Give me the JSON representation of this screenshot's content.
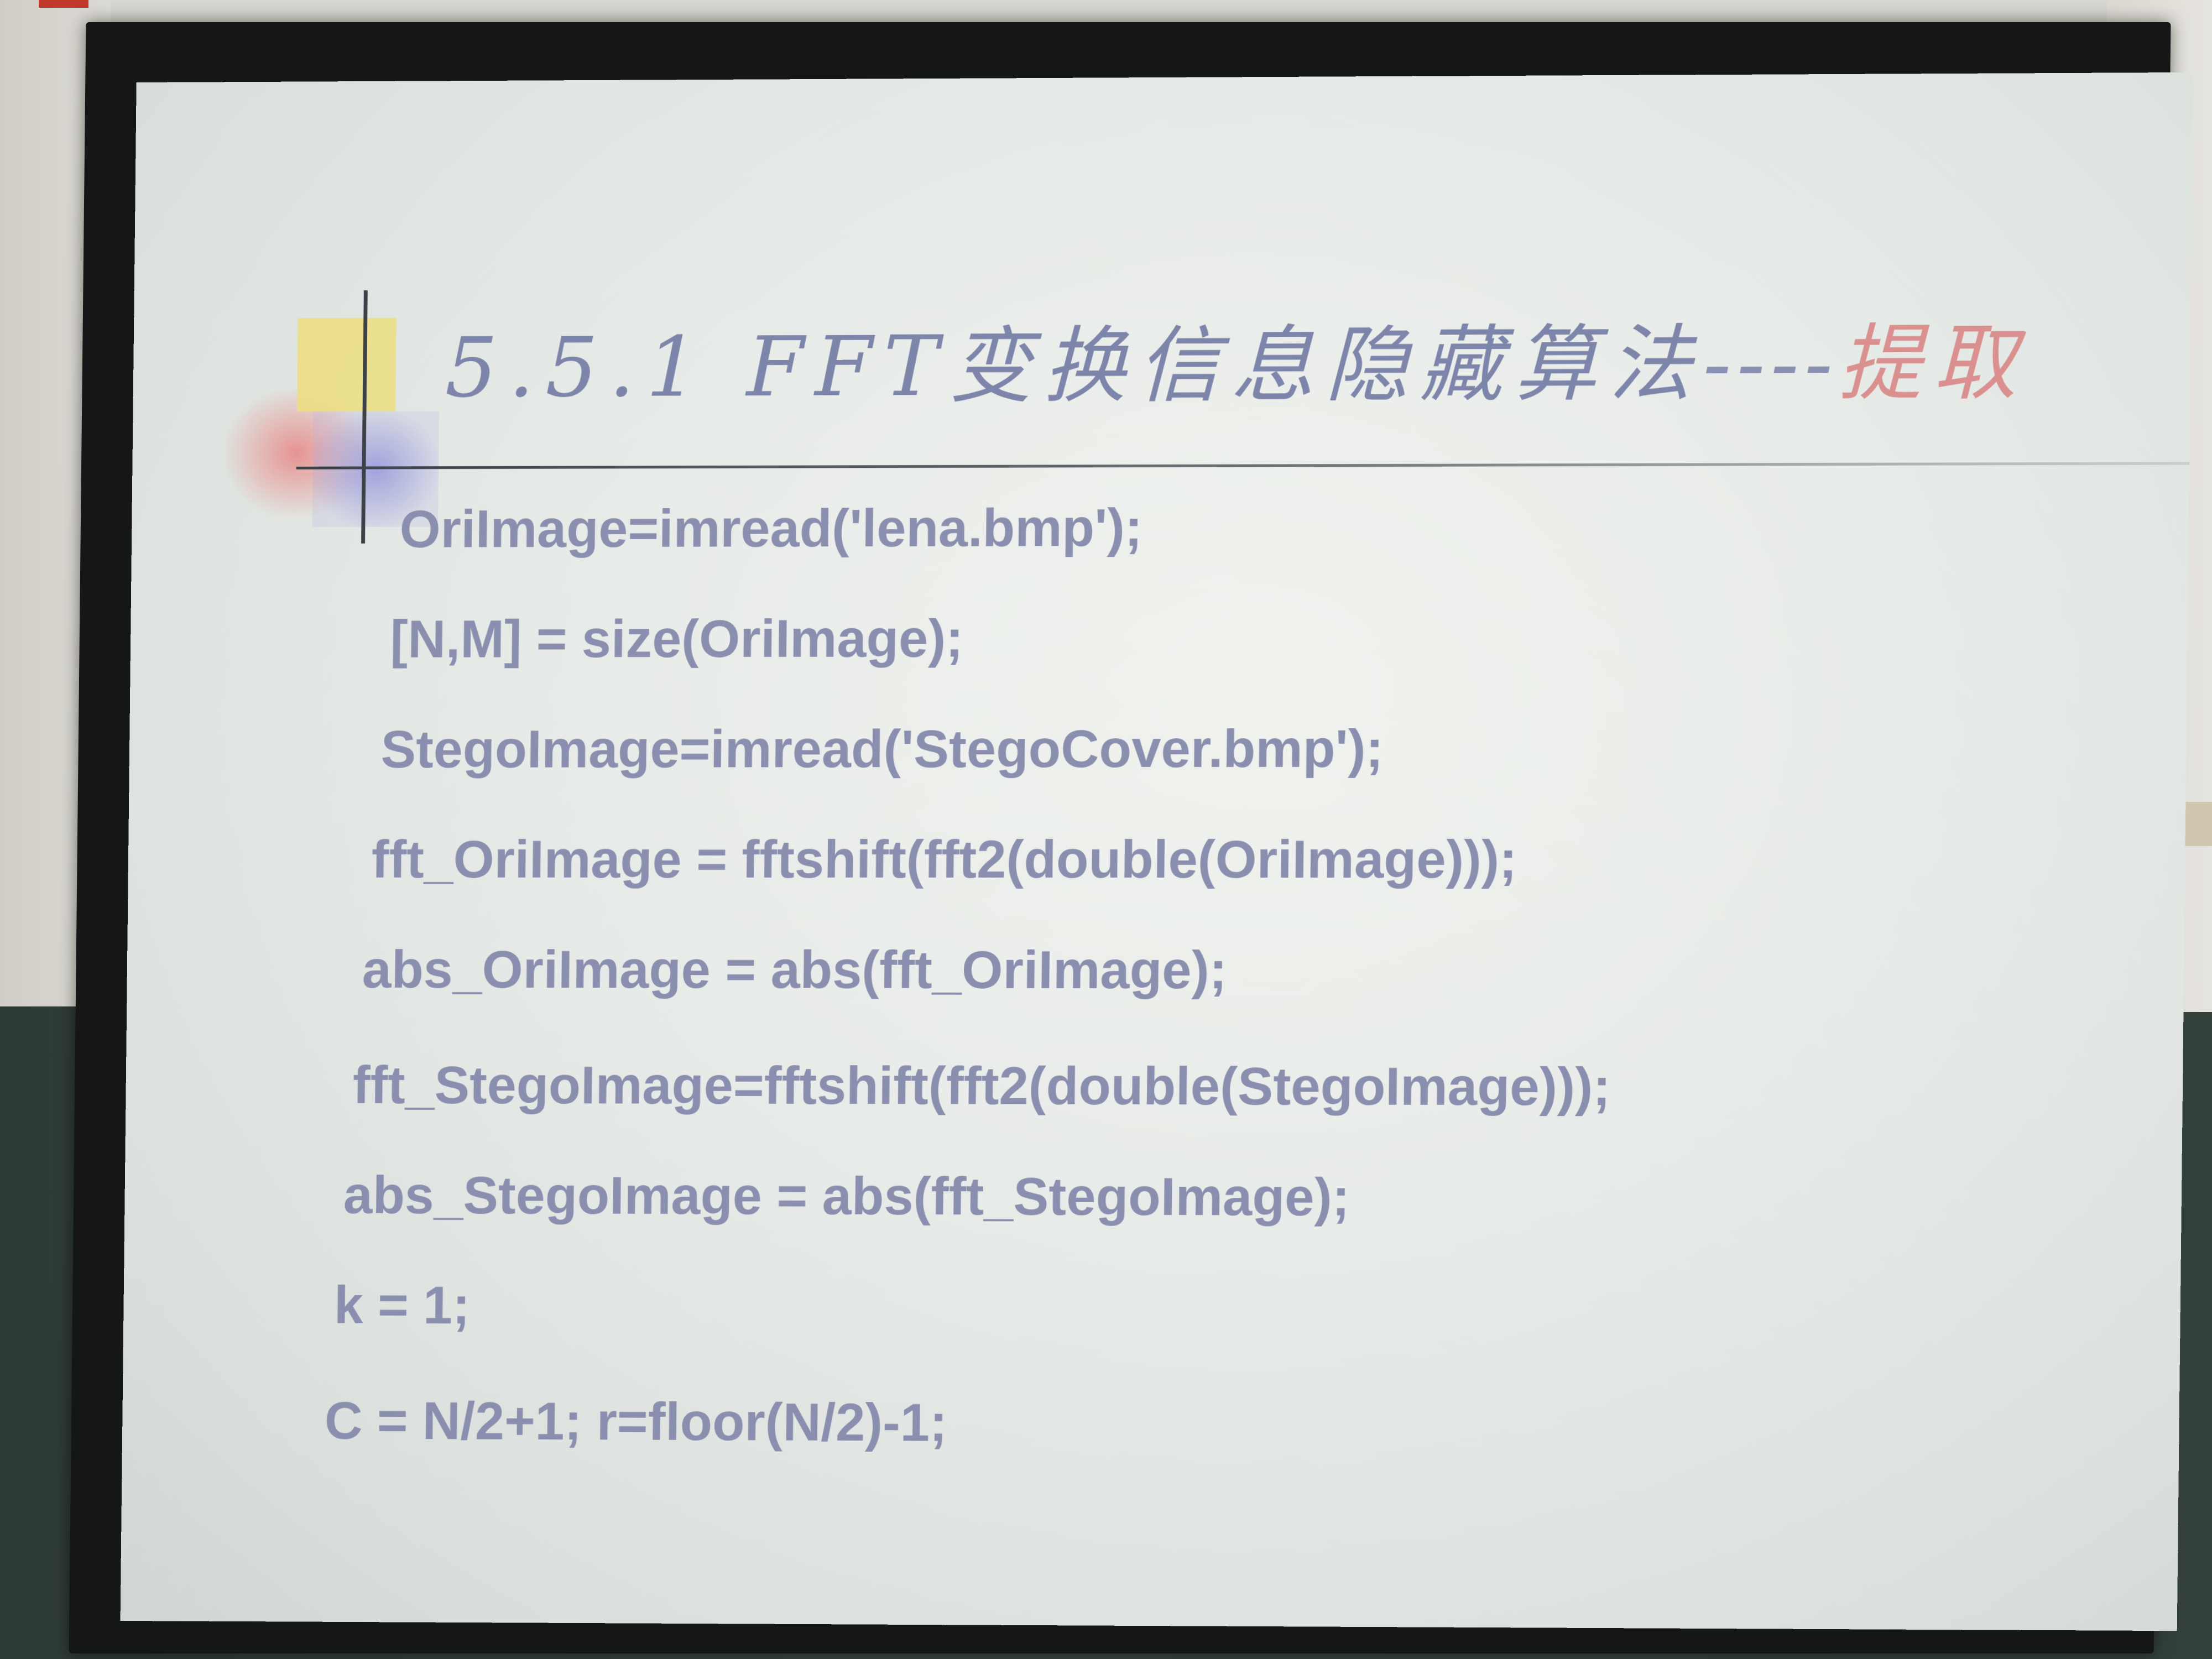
{
  "slide": {
    "title": {
      "prefix": "5.5.1 FFT变换信息隐藏算法",
      "dashes": "----",
      "suffix": "提取"
    },
    "code_lines": [
      "OriImage=imread('lena.bmp');",
      "[N,M] = size(OriImage);",
      "StegoImage=imread('StegoCover.bmp');",
      "fft_OriImage = fftshift(fft2(double(OriImage)));",
      "abs_OriImage = abs(fft_OriImage);",
      "fft_StegoImage=fftshift(fft2(double(StegoImage)));",
      "abs_StegoImage = abs(fft_StegoImage);",
      "k = 1;",
      "C = N/2+1; r=floor(N/2)-1;"
    ],
    "colors": {
      "title": "#7e85ab",
      "title_accent": "#d9908f",
      "code": "#8b8faf",
      "background": "#e7ebe7"
    }
  }
}
